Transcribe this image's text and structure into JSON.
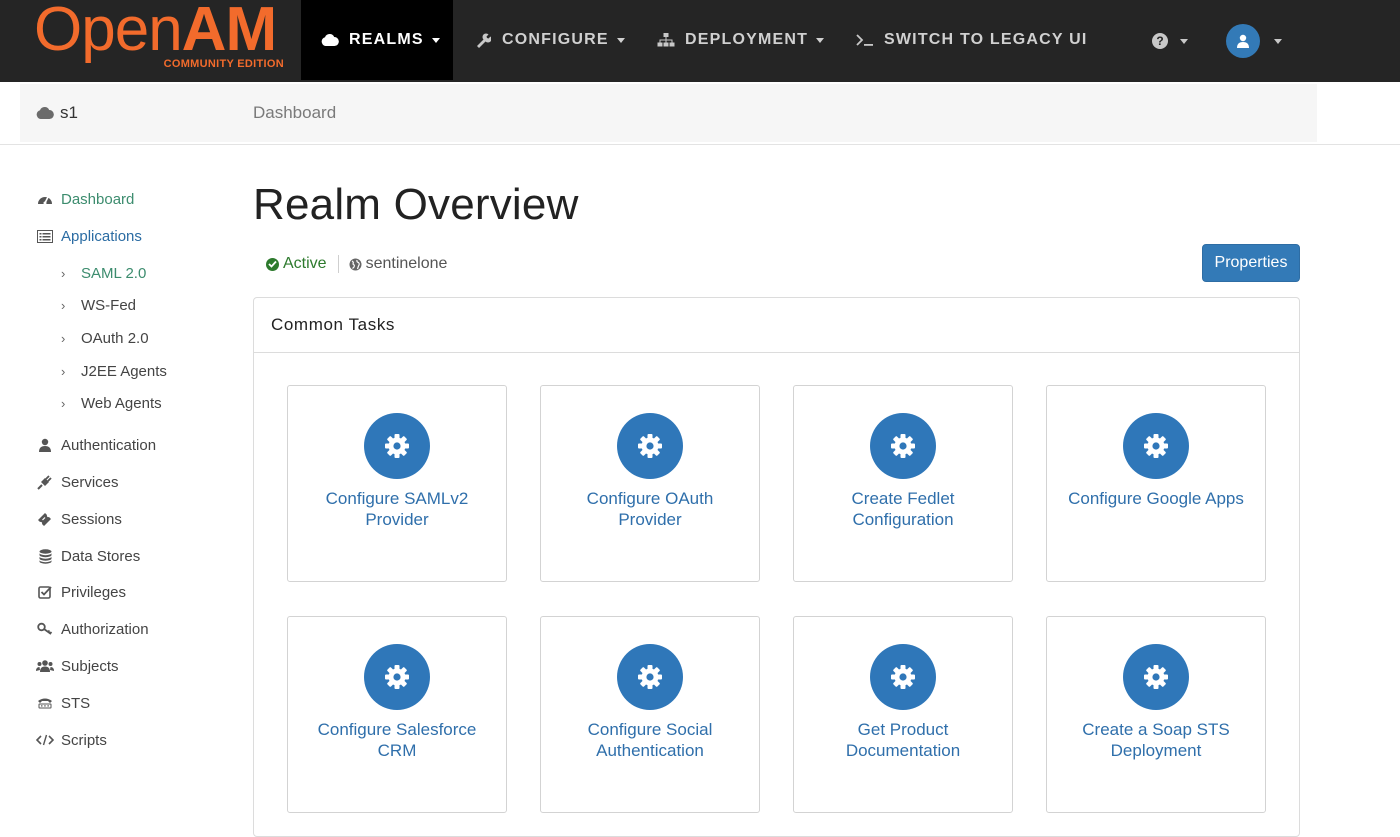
{
  "brand": {
    "logo_open": "Open",
    "logo_am": "AM",
    "logo_sub": "COMMUNITY EDITION",
    "color": "#f26b2c"
  },
  "nav": {
    "items": [
      {
        "label": "REALMS",
        "icon": "cloud-icon",
        "active": true
      },
      {
        "label": "CONFIGURE",
        "icon": "wrench-icon"
      },
      {
        "label": "DEPLOYMENT",
        "icon": "sitemap-icon"
      },
      {
        "label": "SWITCH TO LEGACY UI",
        "icon": "terminal-icon"
      }
    ],
    "help_icon": "question-circle-icon",
    "user_icon": "user-icon"
  },
  "subbar": {
    "realm": "s1",
    "breadcrumb": "Dashboard"
  },
  "sidebar": {
    "items": [
      {
        "label": "Dashboard",
        "icon": "dashboard-icon"
      },
      {
        "label": "Applications",
        "icon": "list-icon"
      },
      {
        "label": "SAML 2.0"
      },
      {
        "label": "WS-Fed"
      },
      {
        "label": "OAuth 2.0"
      },
      {
        "label": "J2EE Agents"
      },
      {
        "label": "Web Agents"
      },
      {
        "label": "Authentication",
        "icon": "user-icon"
      },
      {
        "label": "Services",
        "icon": "plug-icon"
      },
      {
        "label": "Sessions",
        "icon": "ticket-icon"
      },
      {
        "label": "Data Stores",
        "icon": "database-icon"
      },
      {
        "label": "Privileges",
        "icon": "check-square-icon"
      },
      {
        "label": "Authorization",
        "icon": "key-icon"
      },
      {
        "label": "Subjects",
        "icon": "users-icon"
      },
      {
        "label": "STS",
        "icon": "tty-icon"
      },
      {
        "label": "Scripts",
        "icon": "code-icon"
      }
    ]
  },
  "main": {
    "title": "Realm Overview",
    "status": "Active",
    "realm_alias": "sentinelone",
    "properties_button": "Properties",
    "panel_title": "Common Tasks",
    "tasks": [
      {
        "line1": "Configure SAMLv2",
        "line2": "Provider"
      },
      {
        "line1": "Configure OAuth",
        "line2": "Provider"
      },
      {
        "line1": "Create Fedlet",
        "line2": "Configuration"
      },
      {
        "line1": "Configure Google Apps",
        "line2": ""
      },
      {
        "line1": "Configure Salesforce",
        "line2": "CRM"
      },
      {
        "line1": "Configure Social",
        "line2": "Authentication"
      },
      {
        "line1": "Get Product",
        "line2": "Documentation"
      },
      {
        "line1": "Create a Soap STS",
        "line2": "Deployment"
      }
    ]
  },
  "colors": {
    "navbar": "#252525",
    "primary": "#337ab7",
    "link": "#2f6fab",
    "active_green": "#2d7a2d"
  }
}
